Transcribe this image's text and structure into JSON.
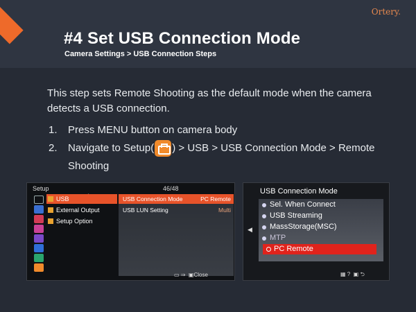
{
  "brand": "Ortery.",
  "title": "#4 Set USB Connection Mode",
  "subtitle": "Camera Settings > USB Connection Steps",
  "intro": "This step sets Remote Shooting as the default mode when the camera detects a USB connection.",
  "steps": [
    {
      "num": "1.",
      "text": "Press MENU button on camera body"
    },
    {
      "num": "2.",
      "text_before": "Navigate to Setup(",
      "icon": "toolbox-icon",
      "text_after": ") > USB > USB Connection Mode > Remote Shooting"
    }
  ],
  "camera1": {
    "menu_title": "Setup",
    "page": "46/48",
    "left_items": [
      "USB",
      "External Output",
      "Setup Option"
    ],
    "right_items": [
      {
        "label": "USB Connection Mode",
        "value": "PC Remote"
      },
      {
        "label": "USB LUN Setting",
        "value": "Multi"
      }
    ],
    "footer": "Close"
  },
  "camera2": {
    "menu_title": "USB Connection Mode",
    "options": [
      "Sel. When Connect",
      "USB Streaming",
      "MassStorage(MSC)",
      "MTP",
      "PC Remote"
    ],
    "selected": "PC Remote"
  },
  "colors": {
    "accent": "#ee6a2a",
    "selection": "#e7532a",
    "background": "#262b35"
  }
}
